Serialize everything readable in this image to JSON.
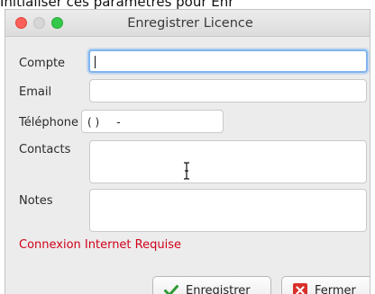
{
  "background": {
    "partial_text": "Initialiser ces paramètres pour Enr"
  },
  "window": {
    "title": "Enregistrer Licence"
  },
  "form": {
    "account_label": "Compte",
    "account_value": "",
    "email_label": "Email",
    "email_value": "",
    "phone_label": "Téléphone",
    "phone_value": "( )     -",
    "contacts_label": "Contacts",
    "contacts_value": "",
    "notes_label": "Notes",
    "notes_value": ""
  },
  "notice": {
    "text": "Connexion Internet Requise",
    "color": "#d0021b"
  },
  "buttons": {
    "save_label": "Enregistrer",
    "save_icon": "checkmark-icon",
    "close_label": "Fermer",
    "close_icon": "close-x-icon"
  },
  "colors": {
    "focus_ring": "#7fb4ef",
    "check_green": "#2e9a35",
    "close_red": "#d9302a"
  }
}
